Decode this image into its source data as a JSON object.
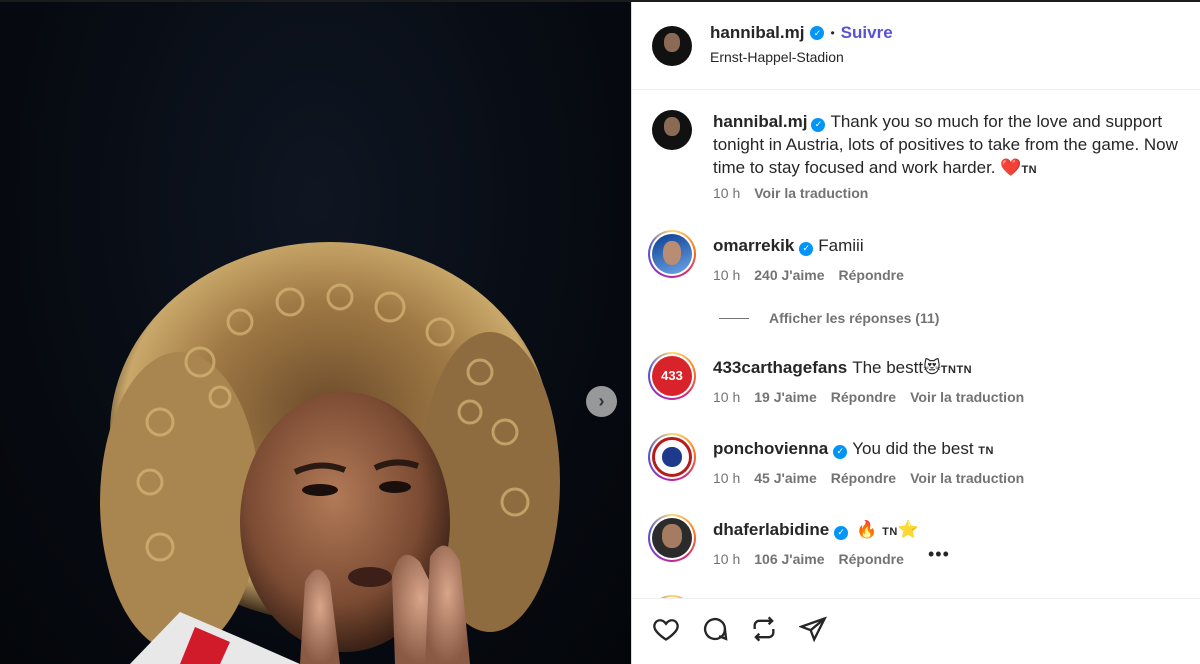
{
  "header": {
    "username": "hannibal.mj",
    "separator": "•",
    "follow_label": "Suivre",
    "location": "Ernst-Happel-Stadion"
  },
  "caption": {
    "username": "hannibal.mj",
    "text": "Thank you so much for the love and support tonight in Austria, lots of positives to take from the game. Now time to stay focused and work harder.",
    "emoji": "❤️",
    "flag": "TN",
    "time": "10 h",
    "translate": "Voir la traduction"
  },
  "comments": [
    {
      "username": "omarrekik",
      "verified": true,
      "text": "Famiii",
      "time": "10 h",
      "likes": "240 J'aime",
      "reply": "Répondre"
    },
    {
      "username": "433carthagefans",
      "verified": false,
      "text": "The bestt",
      "emoji": "😻",
      "flag": "TNTN",
      "time": "10 h",
      "likes": "19 J'aime",
      "reply": "Répondre",
      "translate": "Voir la traduction"
    },
    {
      "username": "ponchovienna",
      "verified": true,
      "text": "You did the best",
      "flag": "TN",
      "time": "10 h",
      "likes": "45 J'aime",
      "reply": "Répondre",
      "translate": "Voir la traduction"
    },
    {
      "username": "dhaferlabidine",
      "verified": true,
      "emoji1": "🔥",
      "flag": "TN",
      "emoji2": "⭐",
      "time": "10 h",
      "likes": "106 J'aime",
      "reply": "Répondre",
      "more": "•••"
    }
  ],
  "view_replies": "Afficher les réponses (11)",
  "icons": {
    "next": "chevron-right-icon",
    "like": "heart-icon",
    "comment": "comment-icon",
    "repost": "repost-icon",
    "share": "share-icon",
    "verified": "verified-badge-icon"
  },
  "colors": {
    "follow": "#5b51d8",
    "verified": "#0095f6",
    "muted": "#737373"
  }
}
